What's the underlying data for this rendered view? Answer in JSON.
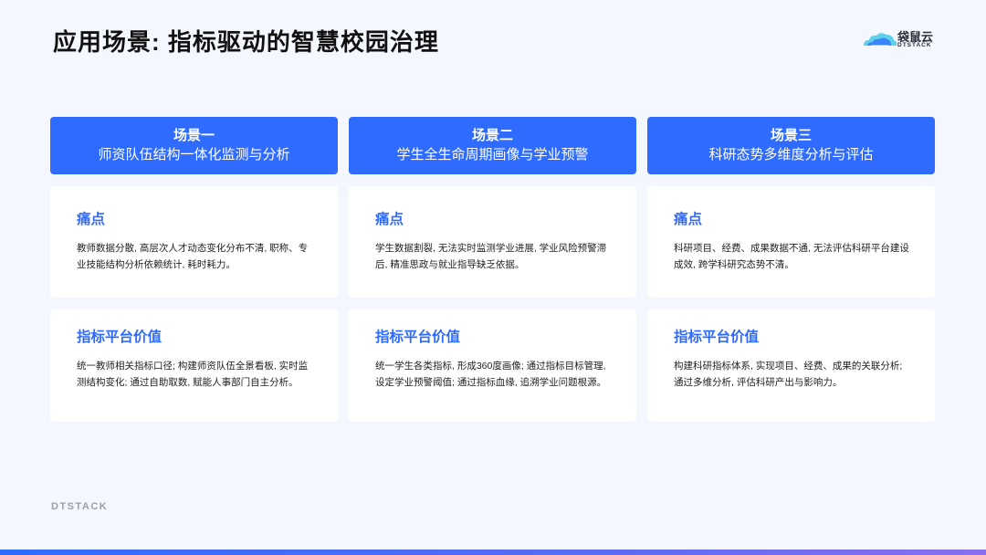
{
  "title": "应用场景: 指标驱动的智慧校园治理",
  "logo": {
    "cn": "袋鼠云",
    "en": "DTSTACK",
    "icon": "cloud-logo-icon"
  },
  "scenarios": [
    {
      "label": "场景一",
      "name": "师资队伍结构一体化监测与分析",
      "pain_title": "痛点",
      "pain_text": "教师数据分散, 高层次人才动态变化分布不清, 职称、专业技能结构分析依赖统计, 耗时耗力。",
      "value_title": "指标平台价值",
      "value_text": "统一教师相关指标口径; 构建师资队伍全景看板, 实时监测结构变化; 通过自助取数, 赋能人事部门自主分析。"
    },
    {
      "label": "场景二",
      "name": "学生全生命周期画像与学业预警",
      "pain_title": "痛点",
      "pain_text": "学生数据割裂, 无法实时监测学业进展, 学业风险预警滞后, 精准思政与就业指导缺乏依据。",
      "value_title": "指标平台价值",
      "value_text": "统一学生各类指标, 形成360度画像; 通过指标目标管理, 设定学业预警阈值; 通过指标血缘, 追溯学业问题根源。"
    },
    {
      "label": "场景三",
      "name": "科研态势多维度分析与评估",
      "pain_title": "痛点",
      "pain_text": "科研项目、经费、成果数据不通, 无法评估科研平台建设成效, 跨学科研究态势不清。",
      "value_title": "指标平台价值",
      "value_text": "构建科研指标体系, 实现项目、经费、成果的关联分析; 通过多维分析, 评估科研产出与影响力。"
    }
  ],
  "footer": {
    "brand": "DTSTACK"
  },
  "colors": {
    "accent": "#2f6bff",
    "background": "#f4f7fd"
  }
}
